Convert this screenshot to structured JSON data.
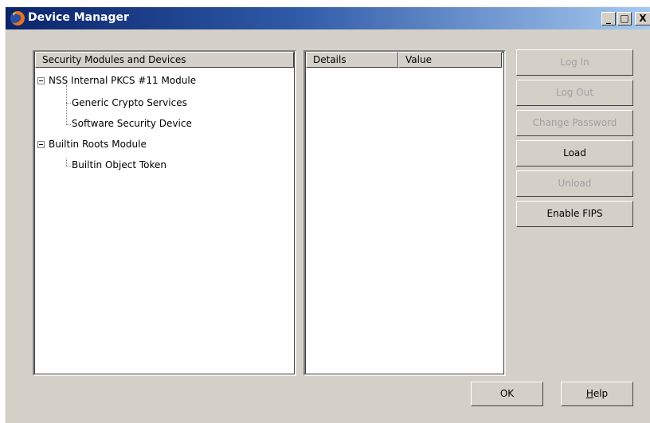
{
  "window": {
    "title": "Device Manager",
    "controls": {
      "minimize": "_",
      "maximize": "□",
      "close": "X"
    }
  },
  "modules_panel": {
    "header": "Security Modules and Devices",
    "items": [
      {
        "label": "NSS Internal PKCS #11 Module",
        "expanded": true,
        "children": [
          {
            "label": "Generic Crypto Services"
          },
          {
            "label": "Software Security Device"
          }
        ]
      },
      {
        "label": "Builtin Roots Module",
        "expanded": true,
        "children": [
          {
            "label": "Builtin Object Token"
          }
        ]
      }
    ]
  },
  "details_panel": {
    "columns": [
      "Details",
      "Value"
    ]
  },
  "actions": {
    "log_in": "Log In",
    "log_out": "Log Out",
    "change_password": "Change Password",
    "load": "Load",
    "unload": "Unload",
    "enable_fips": "Enable FIPS"
  },
  "footer": {
    "ok": "OK",
    "help_first": "H",
    "help_rest": "elp"
  },
  "colors": {
    "title_gradient_start": "#0a246a",
    "title_gradient_end": "#a6caf0",
    "dialog_face": "#d4d0c8",
    "disabled_text": "#a0a0a0"
  }
}
